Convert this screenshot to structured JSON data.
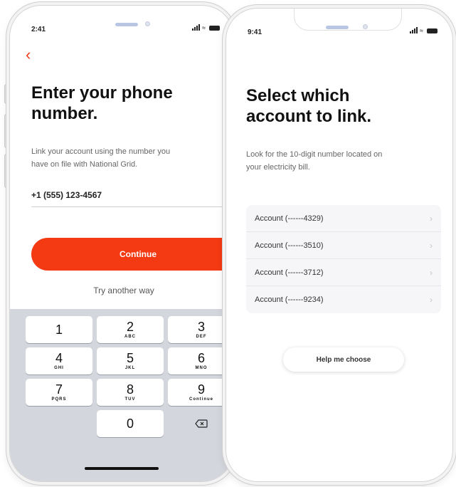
{
  "colors": {
    "accent": "#f43a13",
    "keypad_bg": "#d3d6dc"
  },
  "phone1": {
    "time": "2:41",
    "back_icon": "chevron-left",
    "title_line1": "Enter your phone",
    "title_line2": "number.",
    "description_line1": "Link your account using the number you",
    "description_line2": "have on file with National Grid.",
    "phone_value": "+1 (555) 123-4567",
    "continue_label": "Continue",
    "try_another_label": "Try another way",
    "keypad": {
      "keys": [
        {
          "num": "1",
          "sub": ""
        },
        {
          "num": "2",
          "sub": "ABC"
        },
        {
          "num": "3",
          "sub": "DEF"
        },
        {
          "num": "4",
          "sub": "GHI"
        },
        {
          "num": "5",
          "sub": "JKL"
        },
        {
          "num": "6",
          "sub": "MNO"
        },
        {
          "num": "7",
          "sub": "PQRS"
        },
        {
          "num": "8",
          "sub": "TUV"
        },
        {
          "num": "9",
          "sub": "Continue"
        },
        {
          "num": "0",
          "sub": ""
        }
      ],
      "delete_icon": "backspace"
    }
  },
  "phone2": {
    "time": "9:41",
    "title_line1": "Select which",
    "title_line2": "account to link.",
    "description_line1": "Look for the 10-digit number located on",
    "description_line2": "your electricity bill.",
    "accounts": [
      "Account (------4329)",
      "Account (------3510)",
      "Account (------3712)",
      "Account (------9234)"
    ],
    "help_label": "Help me choose"
  }
}
